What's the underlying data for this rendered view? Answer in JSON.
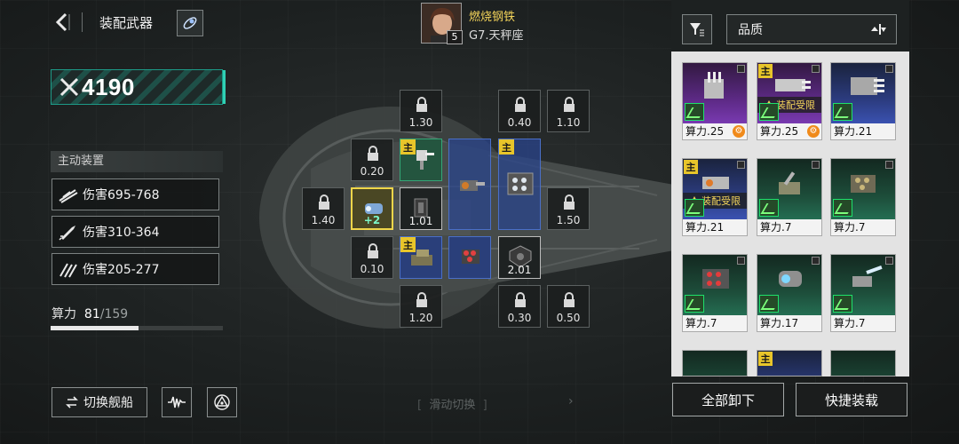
{
  "header": {
    "title": "装配武器"
  },
  "power": {
    "value": "4190"
  },
  "active_equipment": {
    "title": "主动装置",
    "items": [
      {
        "label": "伤害695-768",
        "icon": "slash-icon"
      },
      {
        "label": "伤害310-364",
        "icon": "missile-icon"
      },
      {
        "label": "伤害205-277",
        "icon": "multi-slash-icon"
      }
    ]
  },
  "compute": {
    "label": "算力",
    "used": "81",
    "total": "/159",
    "fraction": 0.51
  },
  "footer": {
    "switch_ship": "切换舰船",
    "swipe_hint": "滑动切换",
    "bracket_left": "[",
    "bracket_right": "]",
    "arrow": "›"
  },
  "commander": {
    "name": "燃烧钢铁",
    "subtitle": "G7.天秤座",
    "level": "5"
  },
  "slots": {
    "tag": "主",
    "locked": [
      "1.30",
      "0.40",
      "1.10",
      "0.20",
      "1.40",
      "1.50",
      "0.10",
      "1.20",
      "0.30",
      "0.50"
    ],
    "filled": {
      "s1_plus": "+2",
      "s2_value": "1.01",
      "s3_value": "2.01"
    }
  },
  "sort": {
    "label": "品质"
  },
  "inventory": {
    "tag": "主",
    "restrict_label": "装配受限",
    "cards": [
      {
        "compute": "算力.25",
        "quality": "purple"
      },
      {
        "compute": "算力.25",
        "quality": "purple"
      },
      {
        "compute": "算力.21",
        "quality": "blue"
      },
      {
        "compute": "算力.21",
        "quality": "blue"
      },
      {
        "compute": "算力.7",
        "quality": "green"
      },
      {
        "compute": "算力.7",
        "quality": "green"
      },
      {
        "compute": "算力.7",
        "quality": "green"
      },
      {
        "compute": "算力.17",
        "quality": "green"
      },
      {
        "compute": "算力.7",
        "quality": "green"
      }
    ]
  },
  "actions": {
    "unequip_all": "全部卸下",
    "quick_equip": "快捷装载"
  }
}
